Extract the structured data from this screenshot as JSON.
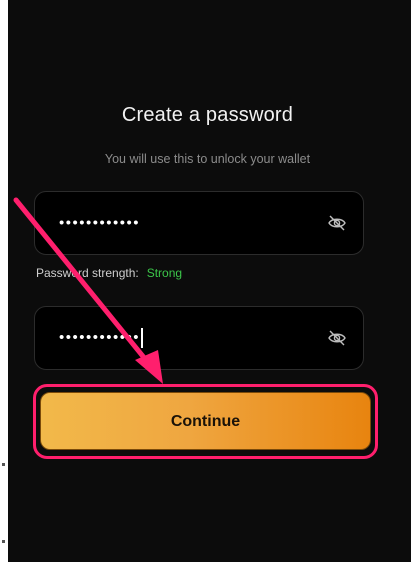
{
  "page": {
    "title": "Create a password",
    "subtitle": "You will use this to unlock your wallet"
  },
  "password_field": {
    "value": "••••••••••••",
    "icon": "eye-slash-icon"
  },
  "strength": {
    "label": "Password strength:",
    "value": "Strong",
    "value_color": "#3cc74a"
  },
  "confirm_field": {
    "value": "••••••••••••",
    "icon": "eye-slash-icon"
  },
  "continue_button": {
    "label": "Continue"
  },
  "colors": {
    "background": "#0c0c0c",
    "button_gradient_start": "#f2b94a",
    "button_gradient_end": "#e8840f",
    "highlight": "#ff1f6d"
  }
}
